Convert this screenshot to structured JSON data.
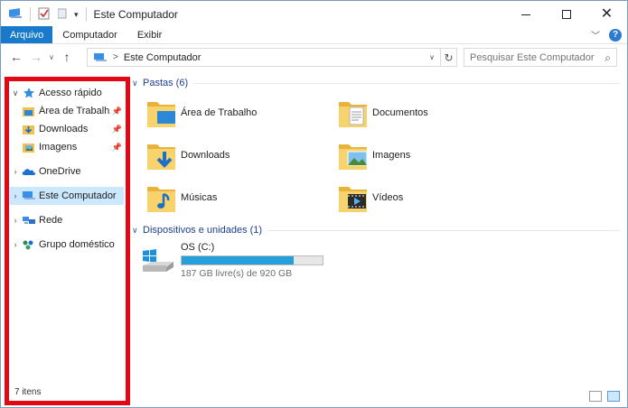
{
  "window": {
    "title": "Este Computador"
  },
  "ribbon": {
    "tabs": [
      {
        "label": "Arquivo"
      },
      {
        "label": "Computador"
      },
      {
        "label": "Exibir"
      }
    ]
  },
  "navigation": {
    "address": "Este Computador",
    "search_placeholder": "Pesquisar Este Computador"
  },
  "sidebar": {
    "items": [
      {
        "label": "Acesso rápido"
      },
      {
        "label": "Área de Trabalho"
      },
      {
        "label": "Downloads"
      },
      {
        "label": "Imagens"
      },
      {
        "label": "OneDrive"
      },
      {
        "label": "Este Computador"
      },
      {
        "label": "Rede"
      },
      {
        "label": "Grupo doméstico"
      }
    ],
    "status": "7 itens",
    "highlight_color": "#e30613"
  },
  "main": {
    "folders_header": "Pastas (6)",
    "folders": [
      {
        "label": "Área de Trabalho"
      },
      {
        "label": "Documentos"
      },
      {
        "label": "Downloads"
      },
      {
        "label": "Imagens"
      },
      {
        "label": "Músicas"
      },
      {
        "label": "Vídeos"
      }
    ],
    "devices_header": "Dispositivos e unidades (1)",
    "drive": {
      "name": "OS (C:)",
      "free_text": "187 GB livre(s) de 920 GB",
      "used_fraction": 0.797
    }
  }
}
